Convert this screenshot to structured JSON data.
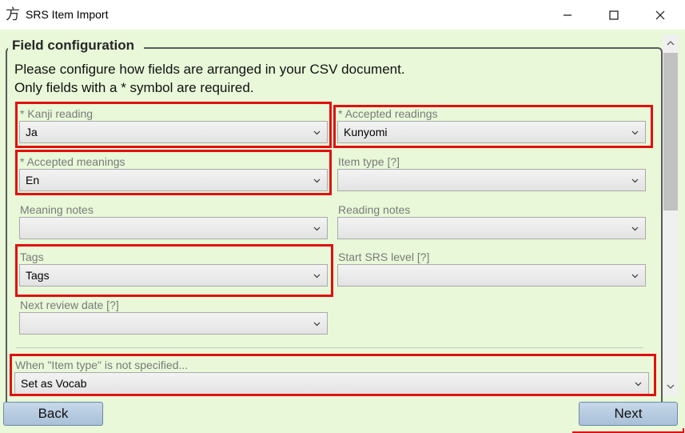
{
  "window": {
    "title": "SRS Item Import",
    "app_icon_glyph": "方",
    "icons": [
      "minimize-icon",
      "maximize-icon",
      "close-icon"
    ]
  },
  "group": {
    "legend": "Field configuration"
  },
  "instructions": {
    "line1": "Please configure how fields are arranged in your CSV document.",
    "line2": "Only fields with a * symbol are required."
  },
  "fields": {
    "kanji_reading": {
      "label": "* Kanji reading",
      "value": "Ja"
    },
    "accepted_readings": {
      "label": "* Accepted readings",
      "value": "Kunyomi"
    },
    "accepted_meanings": {
      "label": "* Accepted meanings",
      "value": "En"
    },
    "item_type": {
      "label": "Item type [?]",
      "value": ""
    },
    "meaning_notes": {
      "label": "Meaning notes",
      "value": ""
    },
    "reading_notes": {
      "label": "Reading notes",
      "value": ""
    },
    "tags": {
      "label": "Tags",
      "value": "Tags"
    },
    "start_srs_level": {
      "label": "Start SRS level [?]",
      "value": ""
    },
    "next_review_date": {
      "label": "Next review date [?]",
      "value": ""
    },
    "item_type_default": {
      "label": "When \"Item type\" is not specified...",
      "value": "Set as Vocab"
    }
  },
  "buttons": {
    "back": "Back",
    "next": "Next"
  },
  "colors": {
    "background": "#e8f8d8",
    "highlight": "#e01010",
    "button": "#b8cce0"
  }
}
